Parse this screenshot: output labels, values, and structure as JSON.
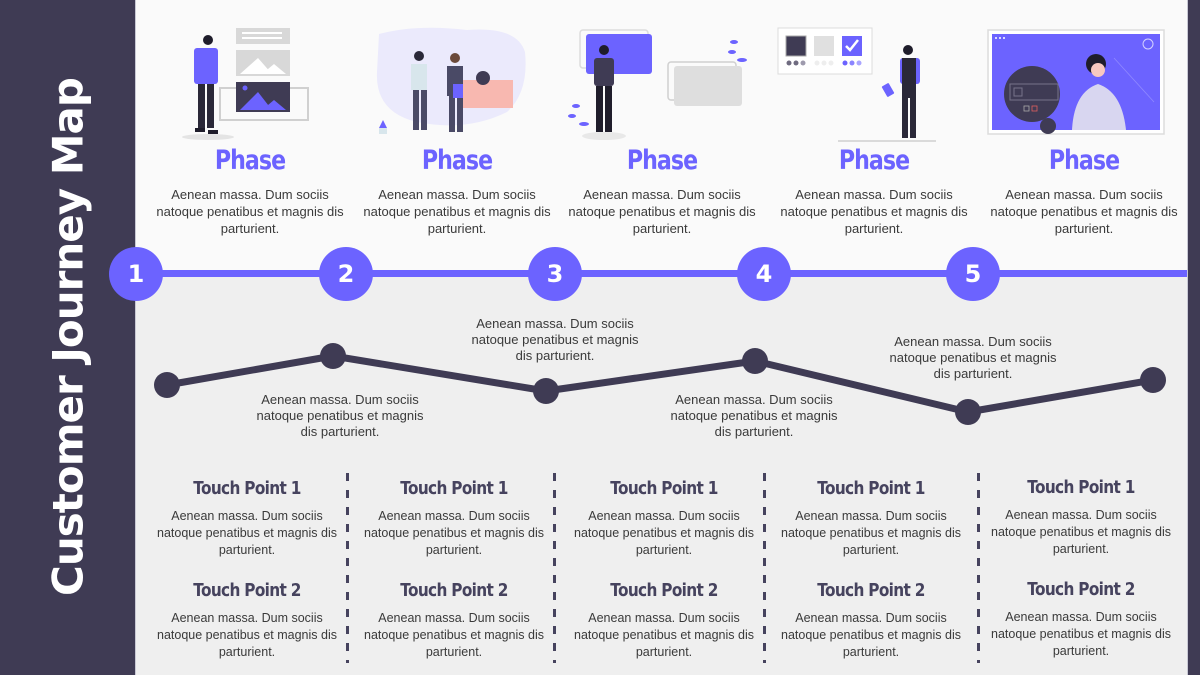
{
  "title": "Customer Journey Map",
  "colors": {
    "accent": "#6c63ff",
    "dark": "#3f3b54",
    "top_bg": "#fafafa",
    "bottom_bg": "#efefef"
  },
  "phases": [
    {
      "step": "1",
      "title": "Phase",
      "desc": "Aenean massa. Dum sociis natoque penatibus et magnis dis parturient.",
      "illustration": "person-with-image-gallery"
    },
    {
      "step": "2",
      "title": "Phase",
      "desc": "Aenean massa. Dum sociis natoque penatibus et magnis dis parturient.",
      "illustration": "business-handshake"
    },
    {
      "step": "3",
      "title": "Phase",
      "desc": "Aenean massa. Dum sociis natoque penatibus et magnis dis parturient.",
      "illustration": "person-viewing-screens"
    },
    {
      "step": "4",
      "title": "Phase",
      "desc": "Aenean massa. Dum sociis natoque penatibus et magnis dis parturient.",
      "illustration": "person-choosing-options"
    },
    {
      "step": "5",
      "title": "Phase",
      "desc": "Aenean massa. Dum sociis natoque penatibus et magnis dis parturient.",
      "illustration": "presenter-video-screen"
    }
  ],
  "journey": {
    "points": [
      {
        "level": "low"
      },
      {
        "level": "high"
      },
      {
        "level": "low"
      },
      {
        "level": "high"
      },
      {
        "level": "lowest"
      },
      {
        "level": "mid"
      }
    ],
    "labels": [
      "Aenean massa. Dum sociis natoque penatibus et magnis dis parturient.",
      "Aenean massa. Dum sociis natoque penatibus et magnis dis parturient.",
      "Aenean massa. Dum sociis natoque penatibus et magnis dis parturient.",
      "Aenean massa. Dum sociis natoque penatibus et magnis dis parturient."
    ]
  },
  "touchpoints": [
    {
      "tp1_title": "Touch Point 1",
      "tp1_desc": "Aenean massa. Dum sociis natoque penatibus et magnis dis parturient.",
      "tp2_title": "Touch Point 2",
      "tp2_desc": "Aenean massa. Dum sociis natoque penatibus et magnis dis parturient."
    },
    {
      "tp1_title": "Touch Point 1",
      "tp1_desc": "Aenean massa. Dum sociis natoque penatibus et magnis dis parturient.",
      "tp2_title": "Touch Point 2",
      "tp2_desc": "Aenean massa. Dum sociis natoque penatibus et magnis dis parturient."
    },
    {
      "tp1_title": "Touch Point 1",
      "tp1_desc": "Aenean massa. Dum sociis natoque penatibus et magnis dis parturient.",
      "tp2_title": "Touch Point 2",
      "tp2_desc": "Aenean massa. Dum sociis natoque penatibus et magnis dis parturient."
    },
    {
      "tp1_title": "Touch Point 1",
      "tp1_desc": "Aenean massa. Dum sociis natoque penatibus et magnis dis parturient.",
      "tp2_title": "Touch Point 2",
      "tp2_desc": "Aenean massa. Dum sociis natoque penatibus et magnis dis parturient."
    },
    {
      "tp1_title": "Touch Point 1",
      "tp1_desc": "Aenean massa. Dum sociis natoque penatibus et magnis dis parturient.",
      "tp2_title": "Touch Point 2",
      "tp2_desc": "Aenean massa. Dum sociis natoque penatibus et magnis dis parturient."
    }
  ]
}
